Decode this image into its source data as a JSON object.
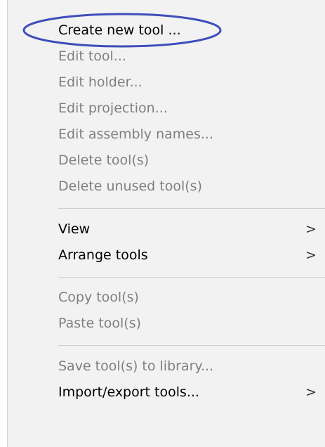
{
  "accent_color": "#3f4dba",
  "menu": {
    "items": [
      {
        "label": "Create new tool ...",
        "enabled": true
      },
      {
        "label": "Edit tool...",
        "enabled": false
      },
      {
        "label": "Edit holder...",
        "enabled": false
      },
      {
        "label": "Edit projection...",
        "enabled": false
      },
      {
        "label": "Edit assembly names...",
        "enabled": false
      },
      {
        "label": "Delete tool(s)",
        "enabled": false
      },
      {
        "label": "Delete unused tool(s)",
        "enabled": false
      },
      {
        "label": "View",
        "enabled": true,
        "submenu": true,
        "chevron": ">"
      },
      {
        "label": "Arrange tools",
        "enabled": true,
        "submenu": true,
        "chevron": ">"
      },
      {
        "label": "Copy tool(s)",
        "enabled": false
      },
      {
        "label": "Paste tool(s)",
        "enabled": false
      },
      {
        "label": "Save tool(s) to library...",
        "enabled": false
      },
      {
        "label": "Import/export tools...",
        "enabled": true,
        "submenu": true,
        "chevron": ">"
      }
    ]
  }
}
